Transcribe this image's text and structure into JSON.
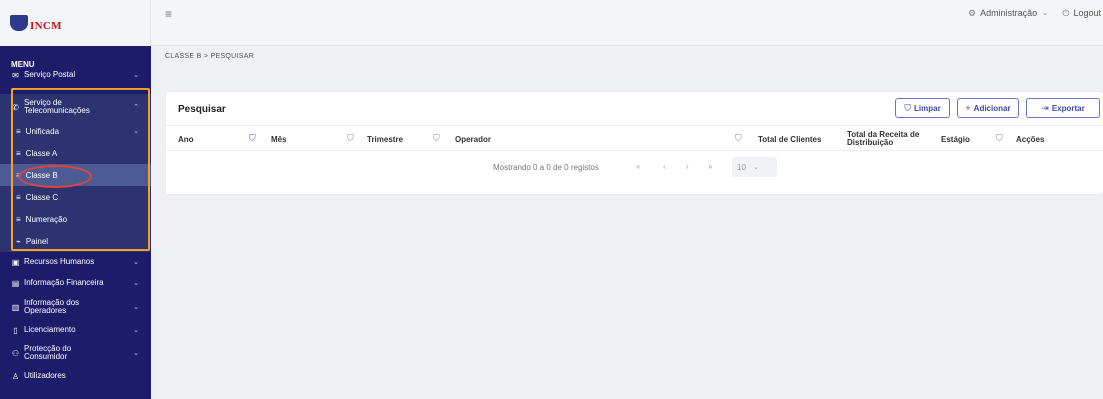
{
  "brand": {
    "logo_text": "INCM"
  },
  "sidebar": {
    "menu_title": "MENU",
    "items": [
      {
        "label": "Serviço Postal",
        "icon": "mail-icon"
      },
      {
        "label": "Serviço de Telecomunicações",
        "icon": "phone-icon"
      },
      {
        "label": "Recursos Humanos",
        "icon": "briefcase-icon"
      },
      {
        "label": "Informação Financeira",
        "icon": "money-icon"
      },
      {
        "label": "Informação dos Operadores",
        "icon": "building-icon"
      },
      {
        "label": "Licenciamento",
        "icon": "document-icon"
      },
      {
        "label": "Protecção do Consumidor",
        "icon": "users-icon"
      },
      {
        "label": "Utilizadores",
        "icon": "user-icon"
      }
    ],
    "sub_items": [
      {
        "label": "Unificada",
        "icon": "list-icon"
      },
      {
        "label": "Classe A",
        "icon": "list-icon"
      },
      {
        "label": "Classe B",
        "icon": "list-icon"
      },
      {
        "label": "Classe C",
        "icon": "list-icon"
      },
      {
        "label": "Numeração",
        "icon": "list-icon"
      },
      {
        "label": "Painel",
        "icon": "chart-icon"
      }
    ]
  },
  "topbar": {
    "admin_label": "Administração",
    "logout_label": "Logout"
  },
  "breadcrumb": "CLASSE B  >  PESQUISAR",
  "search": {
    "title": "Pesquisar",
    "buttons": {
      "limpar": "Limpar",
      "adicionar": "Adicionar",
      "exportar": "Exportar"
    },
    "columns": [
      "Ano",
      "Mês",
      "Trimestre",
      "Operador",
      "Total de Clientes",
      "Total da Receita de Distribuição",
      "Estágio",
      "Acções"
    ],
    "pagination": {
      "showing": "Mostrando 0 a 0 de 0 registos",
      "first": "«",
      "prev": "‹",
      "next": "›",
      "last": "»",
      "per_page": "10"
    }
  },
  "colors": {
    "sidebar_bg": "#1c1c6b",
    "accent": "#3d46a8",
    "highlight_box": "#f2a028",
    "highlight_oval": "#e0443c"
  }
}
